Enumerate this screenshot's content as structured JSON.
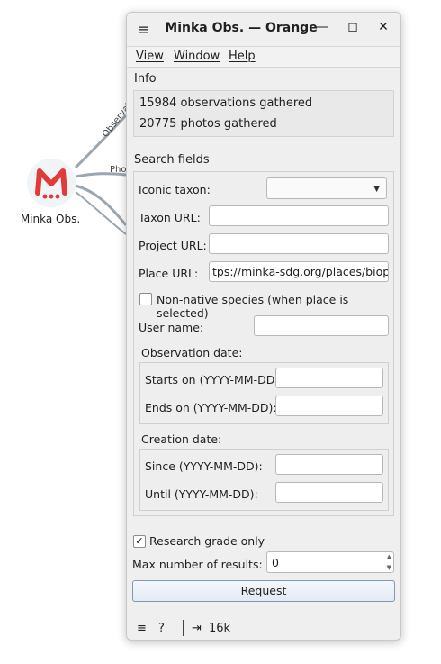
{
  "canvas": {
    "node_label": "Minka Obs.",
    "link_labels": [
      "Observati",
      "Pho"
    ],
    "brand_color": "#e03a3a"
  },
  "window": {
    "title": "Minka Obs. — Orange",
    "controls": {
      "menu": "≡",
      "minimize": "—",
      "maximize": "◻",
      "close": "✕"
    },
    "menu": [
      "View",
      "Window",
      "Help"
    ]
  },
  "info": {
    "title": "Info",
    "observations": "15984 observations gathered",
    "photos": "20775 photos gathered"
  },
  "search": {
    "title": "Search fields",
    "iconic_taxon_label": "Iconic taxon:",
    "iconic_taxon_value": "",
    "taxon_url_label": "Taxon URL:",
    "taxon_url_value": "",
    "project_url_label": "Project URL:",
    "project_url_value": "",
    "place_url_label": "Place URL:",
    "place_url_value": "tps://minka-sdg.org/places/bioprat",
    "non_native_label": "Non-native species (when place is selected)",
    "non_native_checked": false,
    "user_name_label": "User name:",
    "user_name_value": "",
    "obs_date": {
      "title": "Observation date:",
      "starts_label": "Starts on (YYYY-MM-DD):",
      "starts_value": "",
      "ends_label": "Ends on (YYYY-MM-DD):",
      "ends_value": ""
    },
    "creation_date": {
      "title": "Creation date:",
      "since_label": "Since (YYYY-MM-DD):",
      "since_value": "",
      "until_label": "Until (YYYY-MM-DD):",
      "until_value": ""
    }
  },
  "options": {
    "research_grade_label": "Research grade only",
    "research_grade_checked": true,
    "max_results_label": "Max number of results:",
    "max_results_value": "0",
    "request_label": "Request"
  },
  "status": {
    "output_count": "16k"
  }
}
